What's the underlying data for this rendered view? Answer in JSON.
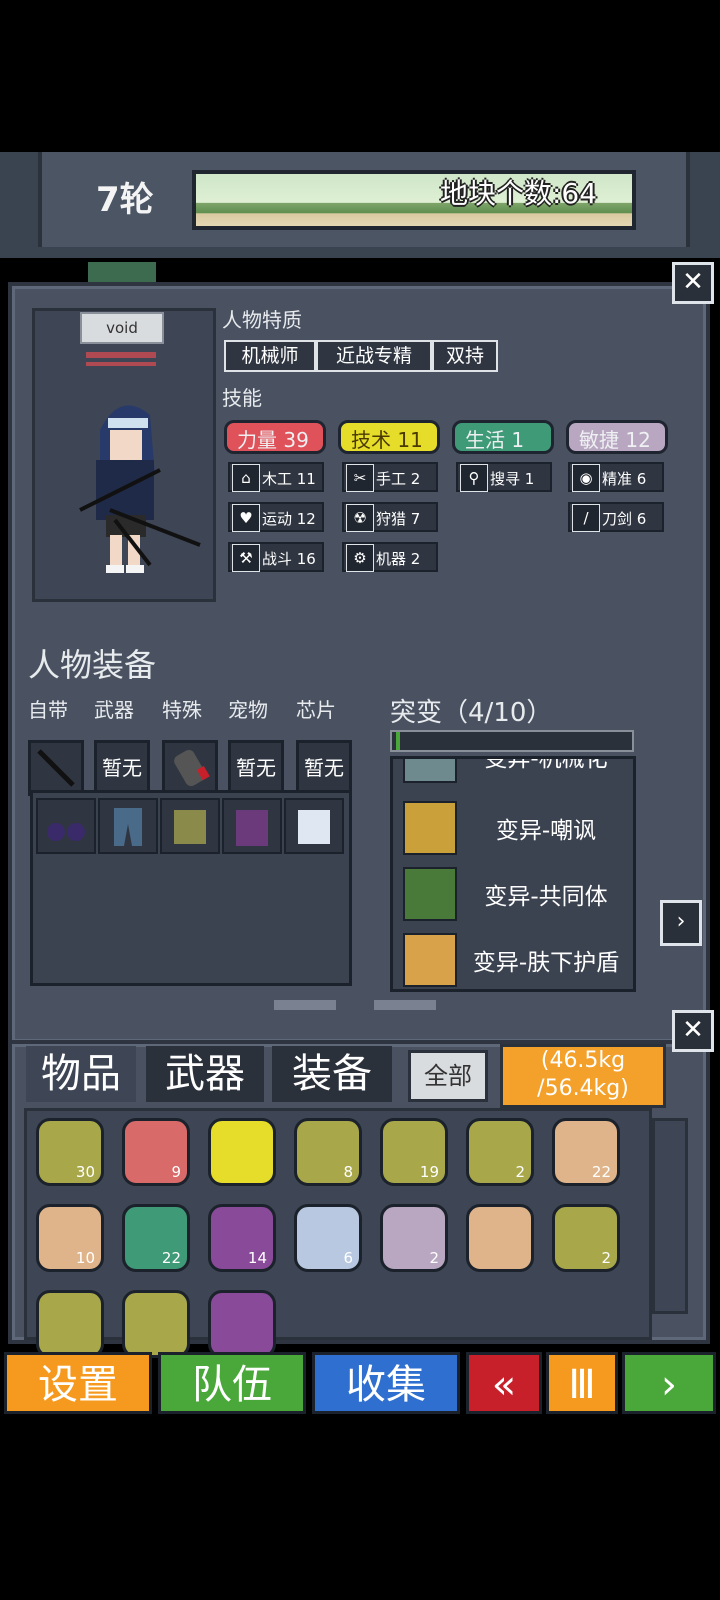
{
  "header": {
    "round": "7轮",
    "tile_count": "地块个数:64"
  },
  "character": {
    "name": "void",
    "traits_title": "人物特质",
    "traits": [
      "机械师",
      "近战专精",
      "双持"
    ],
    "skills_title": "技能",
    "stats": [
      {
        "label": "力量 39",
        "color": "#e0525a"
      },
      {
        "label": "技术 11",
        "color": "#e6dd2a"
      },
      {
        "label": "生活 1",
        "color": "#3f9a78"
      },
      {
        "label": "敏捷 12",
        "color": "#b9a7c2"
      }
    ],
    "subskills": [
      {
        "icon": "house-icon",
        "label": "木工 11"
      },
      {
        "icon": "scissors-icon",
        "label": "手工 2"
      },
      {
        "icon": "magnifier-icon",
        "label": "搜寻 1"
      },
      {
        "icon": "eye-icon",
        "label": "精准 6"
      },
      {
        "icon": "heart-icon",
        "label": "运动 12"
      },
      {
        "icon": "radiation-icon",
        "label": "狩猎 7"
      },
      {
        "icon": "sword-icon",
        "label": "刀剑 6"
      },
      {
        "icon": "wrench-icon",
        "label": "战斗 16"
      },
      {
        "icon": "gear-icon",
        "label": "机器 2"
      }
    ]
  },
  "equipment": {
    "title": "人物装备",
    "slots": [
      {
        "label": "自带",
        "value": ""
      },
      {
        "label": "武器",
        "value": "暂无"
      },
      {
        "label": "特殊",
        "value": ""
      },
      {
        "label": "宠物",
        "value": "暂无"
      },
      {
        "label": "芯片",
        "value": "暂无"
      }
    ]
  },
  "mutation": {
    "title": "突变（4/10）",
    "items": [
      {
        "name": "变异-机械化",
        "color": "#6f8a8f"
      },
      {
        "name": "变异-嘲讽",
        "color": "#caa03a"
      },
      {
        "name": "变异-共同体",
        "color": "#4a7a3a"
      },
      {
        "name": "变异-肤下护盾",
        "color": "#d7a24a"
      }
    ]
  },
  "inventory": {
    "tabs": [
      "物品",
      "武器",
      "装备"
    ],
    "all_label": "全部",
    "weight_line1": "(46.5kg",
    "weight_line2": "/56.4kg)",
    "items": [
      {
        "count": "30",
        "bg": "#a8a84a"
      },
      {
        "count": "9",
        "bg": "#d86a6a"
      },
      {
        "count": "",
        "bg": "#e6dd2a"
      },
      {
        "count": "8",
        "bg": "#a8a84a"
      },
      {
        "count": "19",
        "bg": "#a8a84a"
      },
      {
        "count": "2",
        "bg": "#a8a84a"
      },
      {
        "count": "22",
        "bg": "#e0b48a"
      },
      {
        "count": "10",
        "bg": "#e0b48a"
      },
      {
        "count": "22",
        "bg": "#3f9a78"
      },
      {
        "count": "14",
        "bg": "#8a4a9a"
      },
      {
        "count": "6",
        "bg": "#b8c8e0"
      },
      {
        "count": "2",
        "bg": "#b9a7c2"
      },
      {
        "count": "",
        "bg": "#e0b48a"
      },
      {
        "count": "2",
        "bg": "#a8a84a"
      },
      {
        "count": "",
        "bg": "#a8a84a"
      },
      {
        "count": "",
        "bg": "#a8a84a"
      },
      {
        "count": "",
        "bg": "#8a4a9a"
      }
    ]
  },
  "bottom_buttons": [
    {
      "label": "设置",
      "color": "#f59a1e"
    },
    {
      "label": "队伍",
      "color": "#4aa83a"
    },
    {
      "label": "收集",
      "color": "#2f6fd0"
    },
    {
      "label": "«",
      "color": "#c8202a"
    },
    {
      "label": "Ⅲ",
      "color": "#f59a1e"
    },
    {
      "label": "›",
      "color": "#4aa83a"
    }
  ]
}
